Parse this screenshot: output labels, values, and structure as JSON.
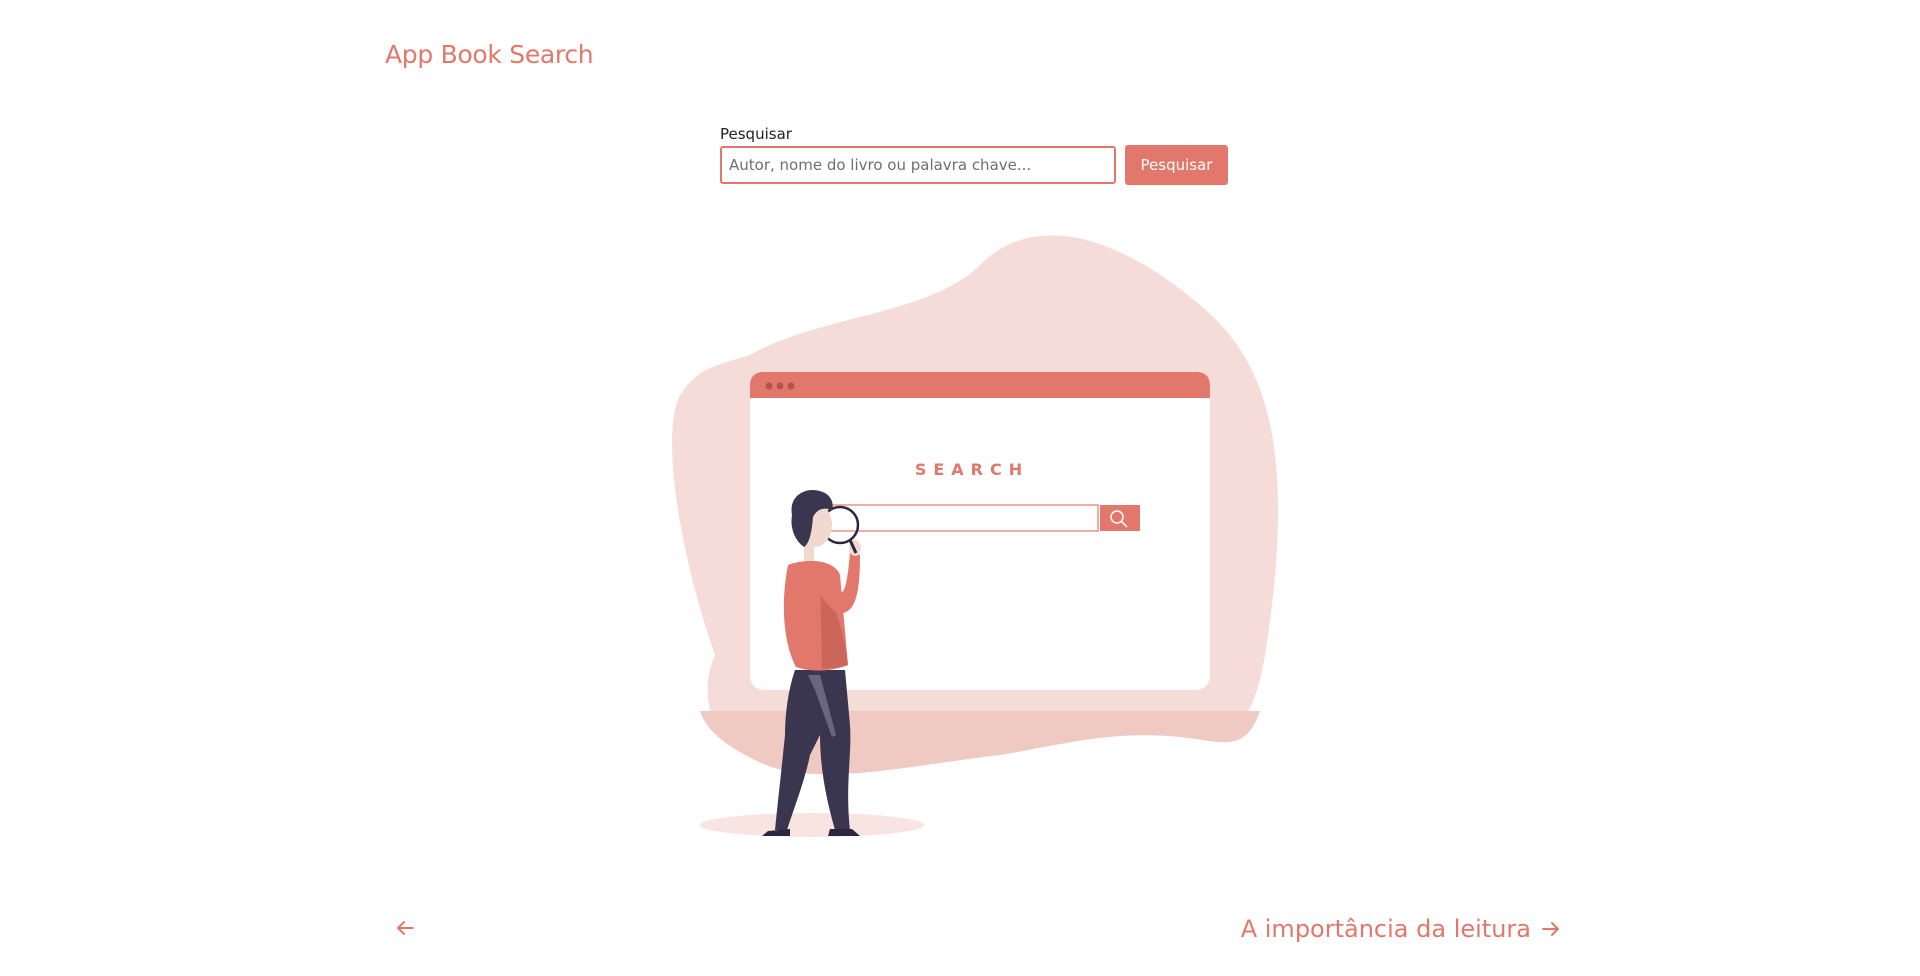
{
  "header": {
    "app_title": "App Book Search"
  },
  "search": {
    "label": "Pesquisar",
    "placeholder": "Autor, nome do livro ou palavra chave...",
    "value": "",
    "button_label": "Pesquisar"
  },
  "illustration": {
    "window_heading": "SEARCH",
    "icon": "person-searching-illustration"
  },
  "navigation": {
    "prev_icon": "arrow-left-icon",
    "next_label": "A importância da leitura",
    "next_icon": "arrow-right-icon"
  },
  "colors": {
    "accent": "#e2786b",
    "blob": "#f6dcd8",
    "blob_bottom": "#f1c9c3",
    "figure_dark": "#3b3650"
  }
}
